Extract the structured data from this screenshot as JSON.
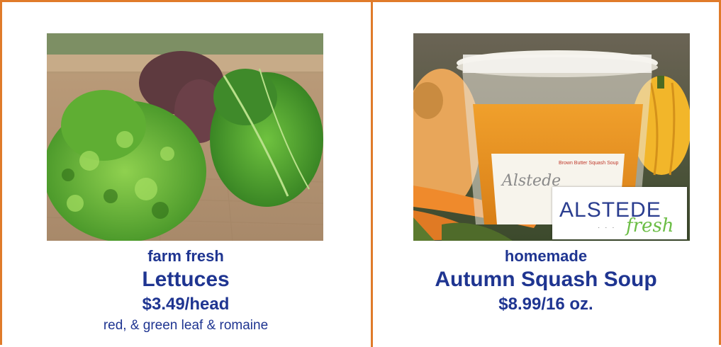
{
  "products": [
    {
      "tagline": "farm fresh",
      "name": "Lettuces",
      "price": "$3.49/head",
      "description": "red, & green leaf & romaine"
    },
    {
      "tagline": "homemade",
      "name": "Autumn Squash Soup",
      "price": "$8.99/16 oz.",
      "container_label": "Alstede",
      "logo_main": "ALSTEDE",
      "logo_script": "fresh"
    }
  ],
  "colors": {
    "border": "#e07b2a",
    "text": "#1f3591",
    "logo_green": "#6bbd45"
  }
}
